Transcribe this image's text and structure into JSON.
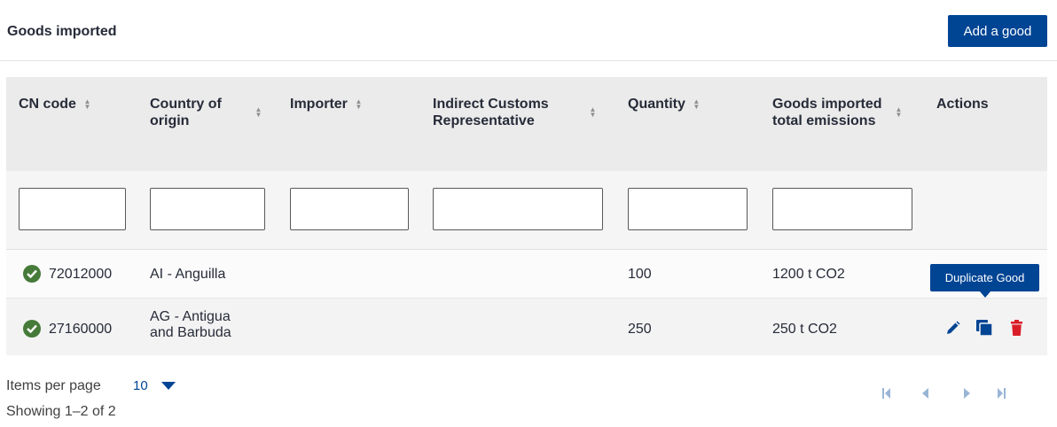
{
  "header": {
    "title": "Goods imported",
    "add_button": "Add a good"
  },
  "table": {
    "columns": [
      {
        "label": "CN code"
      },
      {
        "label": "Country of origin"
      },
      {
        "label": "Importer"
      },
      {
        "label": "Indirect Customs Representative"
      },
      {
        "label": "Quantity"
      },
      {
        "label": "Goods imported total emissions"
      },
      {
        "label": "Actions"
      }
    ],
    "filters": {
      "cn_code": "",
      "country": "",
      "importer": "",
      "representative": "",
      "quantity": "",
      "emissions": ""
    },
    "rows": [
      {
        "status": "valid",
        "cn_code": "72012000",
        "country": "AI - Anguilla",
        "importer": "",
        "representative": "",
        "quantity": "100",
        "emissions": "1200 t CO2"
      },
      {
        "status": "valid",
        "cn_code": "27160000",
        "country": "AG - Antigua and Barbuda",
        "importer": "",
        "representative": "",
        "quantity": "250",
        "emissions": "250 t CO2"
      }
    ]
  },
  "tooltip": {
    "text": "Duplicate Good"
  },
  "pagination": {
    "items_per_page_label": "Items per page",
    "items_per_page_value": "10",
    "showing": "Showing 1–2 of 2"
  },
  "icons": {
    "status": "check-circle-icon",
    "edit": "pencil-icon",
    "duplicate": "copy-icon",
    "delete": "trash-icon",
    "pagination": [
      "first-page-icon",
      "previous-page-icon",
      "next-page-icon",
      "last-page-icon"
    ]
  },
  "colors": {
    "primary": "#004494",
    "success": "#467a39",
    "danger": "#da1e28",
    "pager_disabled": "#9ab5d6"
  }
}
